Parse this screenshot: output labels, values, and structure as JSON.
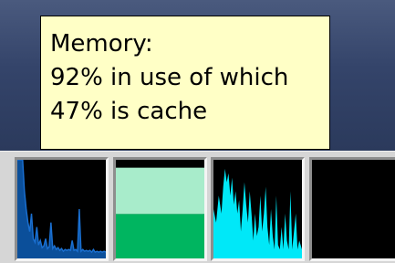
{
  "tooltip": {
    "lines": [
      "Memory:",
      "92% in use of which",
      "47% is cache"
    ]
  },
  "memory": {
    "used_fraction": 0.92,
    "cache_fraction": 0.47
  },
  "graphs": [
    {
      "id": "cpu-load-graph",
      "color": "#1a6fd0",
      "fill": "#0b4f9a"
    },
    {
      "id": "memory-load-graph",
      "used_color": "#00b560",
      "cache_color": "#a8eccb",
      "free_color": "#000000"
    },
    {
      "id": "network-load-graph",
      "color": "#00e8f8"
    },
    {
      "id": "system-load-graph",
      "color": "#000000"
    }
  ],
  "icons": {
    "cpu": "cpu-graph-icon",
    "memory": "memory-graph-icon",
    "network": "network-graph-icon",
    "load": "load-graph-icon"
  }
}
